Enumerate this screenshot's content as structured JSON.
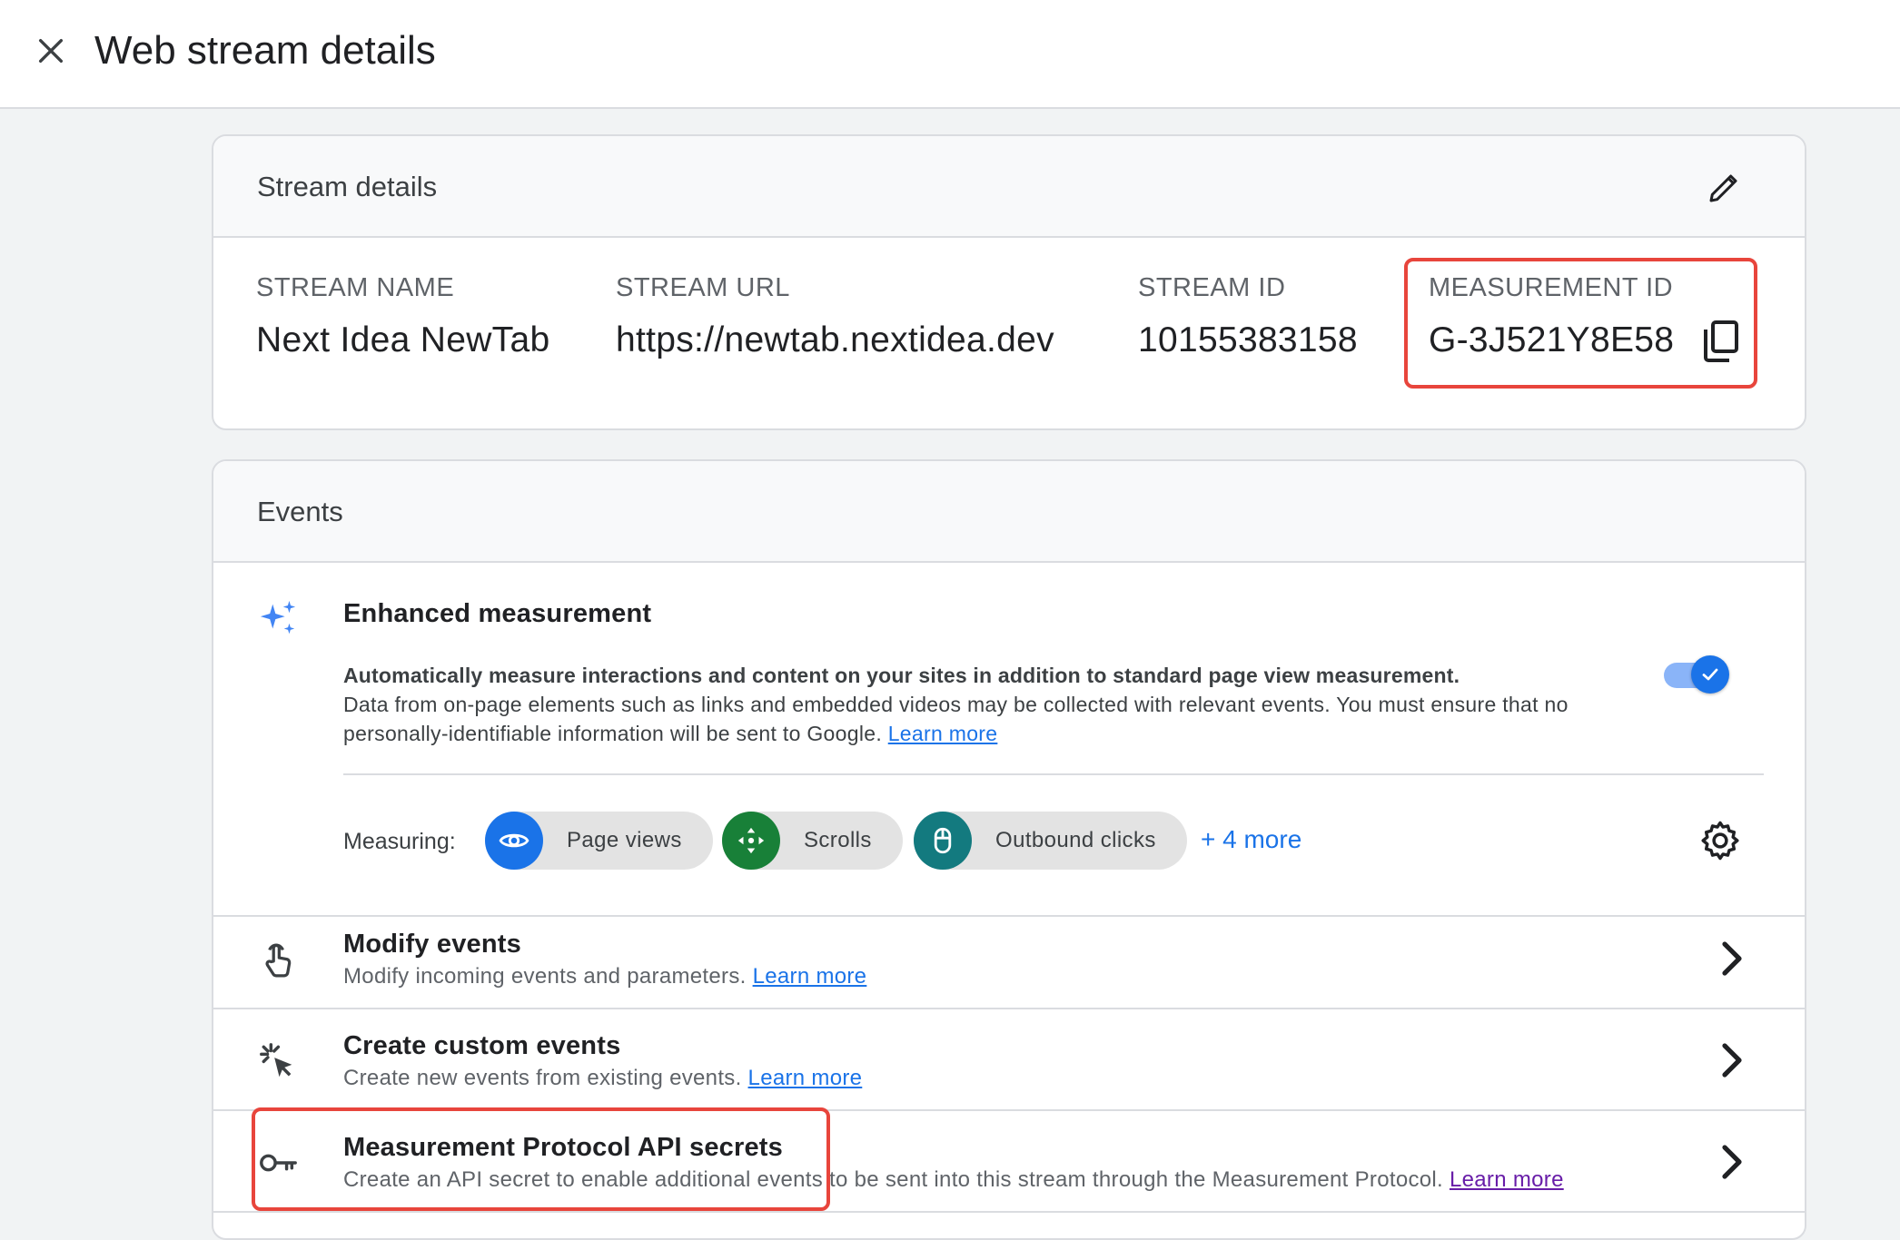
{
  "header": {
    "title": "Web stream details"
  },
  "stream_card": {
    "title": "Stream details",
    "fields": [
      {
        "label": "STREAM NAME",
        "value": "Next Idea NewTab"
      },
      {
        "label": "STREAM URL",
        "value": "https://newtab.nextidea.dev"
      },
      {
        "label": "STREAM ID",
        "value": "10155383158"
      },
      {
        "label": "MEASUREMENT ID",
        "value": "G-3J521Y8E58"
      }
    ]
  },
  "events_card": {
    "title": "Events",
    "enhanced": {
      "title": "Enhanced measurement",
      "desc_bold": "Automatically measure interactions and content on your sites in addition to standard page view measurement.",
      "desc_line2": "Data from on-page elements such as links and embedded videos may be collected with relevant events. You must ensure that no",
      "desc_line3": "personally-identifiable information will be sent to Google.",
      "learn_more": "Learn more",
      "toggle_on": true,
      "measuring_label": "Measuring:",
      "chips": [
        {
          "label": "Page views",
          "color": "#1a73e8",
          "icon": "eye-icon"
        },
        {
          "label": "Scrolls",
          "color": "#188038",
          "icon": "scroll-arrows-icon"
        },
        {
          "label": "Outbound clicks",
          "color": "#137a7f",
          "icon": "mouse-icon"
        }
      ],
      "more": "+ 4 more"
    },
    "rows": [
      {
        "title": "Modify events",
        "desc": "Modify incoming events and parameters.",
        "link": "Learn more",
        "icon": "touch-hand-icon"
      },
      {
        "title": "Create custom events",
        "desc": "Create new events from existing events.",
        "link": "Learn more",
        "icon": "click-cursor-icon"
      },
      {
        "title": "Measurement Protocol API secrets",
        "desc": "Create an API secret to enable additional events to be sent into this stream through the Measurement Protocol.",
        "link": "Learn more",
        "icon": "key-icon"
      }
    ]
  },
  "colors": {
    "accent": "#1a73e8",
    "highlight": "#e8453c",
    "link_visited": "#681da8"
  }
}
